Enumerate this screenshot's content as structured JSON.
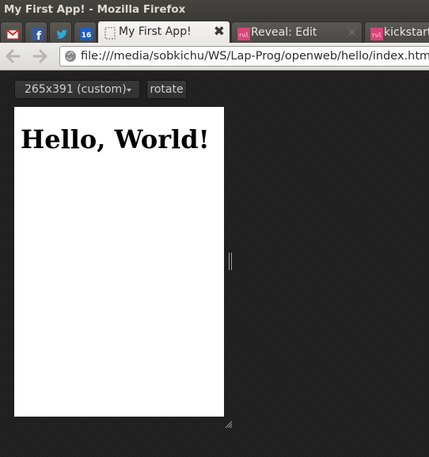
{
  "window": {
    "title": "My First App! - Mozilla Firefox"
  },
  "tabs": [
    {
      "kind": "pinned",
      "icon": "gmail-icon"
    },
    {
      "kind": "pinned",
      "icon": "facebook-icon"
    },
    {
      "kind": "pinned",
      "icon": "twitter-icon"
    },
    {
      "kind": "pinned",
      "icon": "calendar-icon",
      "icon_text": "16"
    },
    {
      "kind": "tab",
      "label": "My First App!",
      "active": true
    },
    {
      "kind": "tab",
      "label": "Reveal: Edit",
      "icon": "rull-icon",
      "icon_text": "rul"
    },
    {
      "kind": "tab",
      "label": "kickstart",
      "icon": "rull-icon",
      "icon_text": "rul"
    }
  ],
  "navbar": {
    "back_icon": "back-arrow-icon",
    "forward_icon": "forward-arrow-icon",
    "url": "file:///media/sobkichu/WS/Lap-Prog/openweb/hello/index.html"
  },
  "responsive_toolbar": {
    "size_label": "265x391 (custom)",
    "rotate_label": "rotate"
  },
  "page": {
    "heading": "Hello, World!"
  },
  "colors": {
    "titlebar_bg": "#3b3a36",
    "content_bg": "#1f1f1f",
    "viewport_bg": "#ffffff"
  }
}
